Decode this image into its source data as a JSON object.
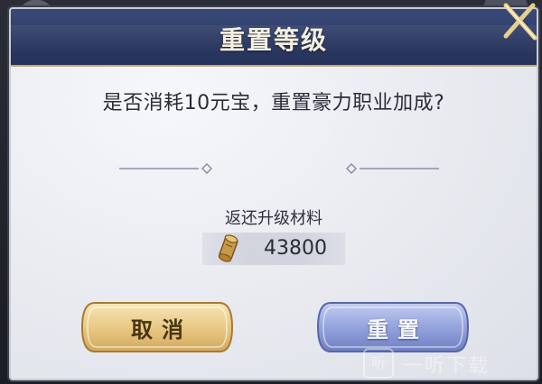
{
  "dialog": {
    "title": "重置等级",
    "question": "是否消耗10元宝，重置豪力职业加成?",
    "section_label": "返还升级材料",
    "reward": {
      "icon": "scroll-icon",
      "value": "43800"
    },
    "buttons": {
      "cancel_label": "取消",
      "confirm_label": "重置"
    }
  },
  "watermark": {
    "logo": "听",
    "text": "一听下载"
  },
  "colors": {
    "header": "#2c3a63",
    "panel": "#eceef3",
    "gold_button": "#e8c987",
    "blue_button": "#8f9fd6"
  }
}
